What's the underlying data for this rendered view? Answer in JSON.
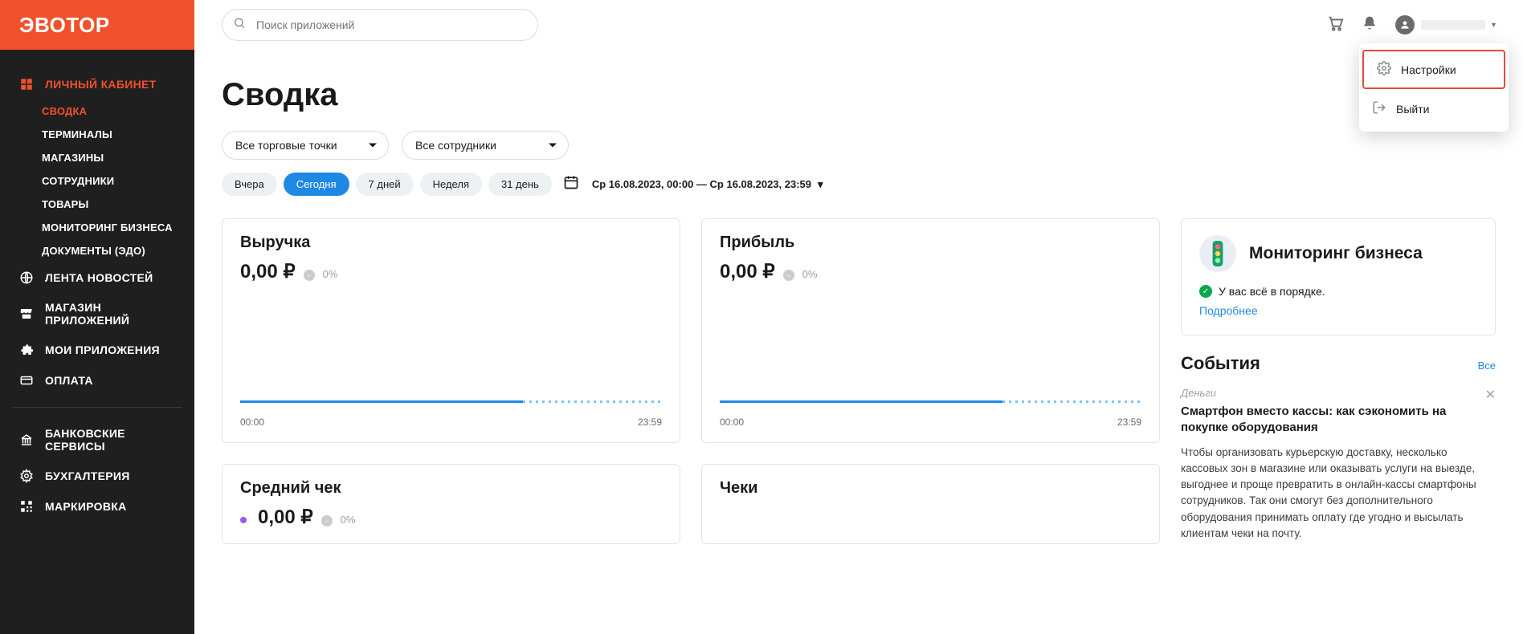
{
  "logo": "ЭВОТОР",
  "search": {
    "placeholder": "Поиск приложений"
  },
  "dropdown": {
    "settings": "Настройки",
    "logout": "Выйти"
  },
  "sidebar": {
    "cabinet": "ЛИЧНЫЙ КАБИНЕТ",
    "sub": {
      "summary": "СВОДКА",
      "terminals": "ТЕРМИНАЛЫ",
      "shops": "МАГАЗИНЫ",
      "staff": "СОТРУДНИКИ",
      "goods": "ТОВАРЫ",
      "monitoring": "МОНИТОРИНГ БИЗНЕСА",
      "docs": "ДОКУМЕНТЫ (ЭДО)"
    },
    "news": "ЛЕНТА НОВОСТЕЙ",
    "appstore": "МАГАЗИН ПРИЛОЖЕНИЙ",
    "myapps": "МОИ ПРИЛОЖЕНИЯ",
    "payment": "ОПЛАТА",
    "bank": "БАНКОВСКИЕ СЕРВИСЫ",
    "accounting": "БУХГАЛТЕРИЯ",
    "marking": "МАРКИРОВКА"
  },
  "page": {
    "title": "Сводка",
    "filter_points": "Все торговые точки",
    "filter_staff": "Все сотрудники",
    "periods": {
      "yesterday": "Вчера",
      "today": "Сегодня",
      "days7": "7 дней",
      "week": "Неделя",
      "days31": "31 день"
    },
    "range": "Ср 16.08.2023, 00:00 — Ср 16.08.2023, 23:59"
  },
  "cards": {
    "revenue": {
      "title": "Выручка",
      "value": "0,00 ₽",
      "delta": "0%",
      "start": "00:00",
      "end": "23:59"
    },
    "profit": {
      "title": "Прибыль",
      "value": "0,00 ₽",
      "delta": "0%",
      "start": "00:00",
      "end": "23:59"
    },
    "avg": {
      "title": "Средний чек",
      "value": "0,00 ₽",
      "delta": "0%"
    },
    "checks": {
      "title": "Чеки"
    }
  },
  "monitoring": {
    "title": "Мониторинг бизнеса",
    "status_text": "У вас всё в порядке.",
    "more": "Подробнее"
  },
  "events": {
    "title": "События",
    "all": "Все",
    "item": {
      "category": "Деньги",
      "headline": "Смартфон вместо кассы: как сэкономить на покупке оборудования",
      "body": "Чтобы организовать курьерскую доставку, несколько кассовых зон в магазине или оказывать услуги на выезде, выгоднее и проще превратить в онлайн-кассы смартфоны сотрудников. Так они смогут без дополнительного оборудования принимать оплату где угодно и высылать клиентам чеки на почту."
    }
  }
}
